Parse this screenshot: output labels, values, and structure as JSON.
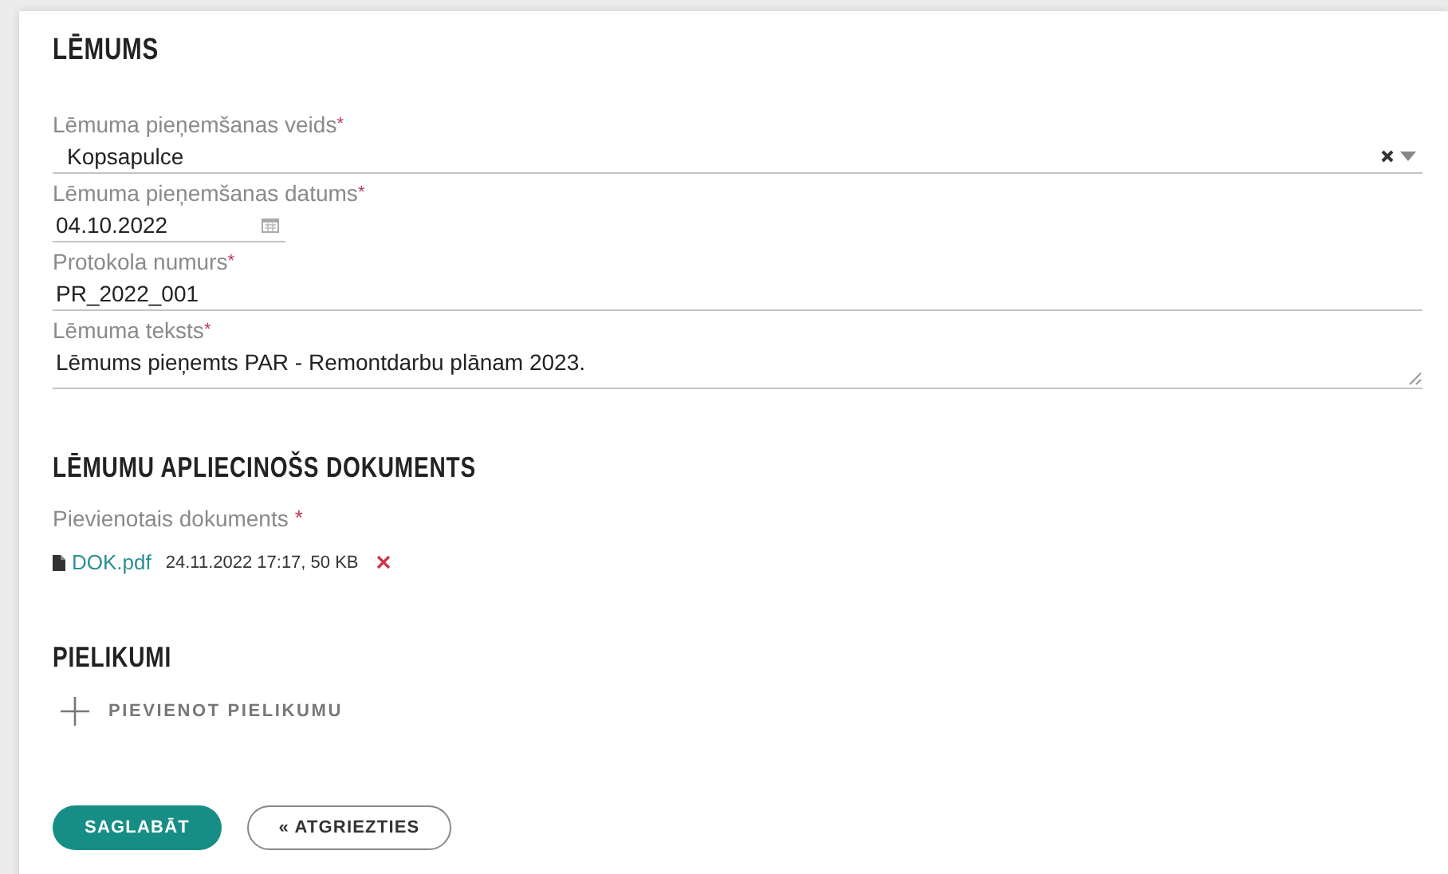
{
  "title": "LĒMUMS",
  "fields": [
    {
      "kind": "select",
      "label": "Lēmuma pieņemšanas veids",
      "required_mark": "*",
      "value": "Kopsapulce"
    },
    {
      "kind": "date",
      "label": "Lēmuma pieņemšanas datums",
      "required_mark": "*",
      "value": "04.10.2022"
    },
    {
      "kind": "text",
      "label": "Protokola numurs",
      "required_mark": "*",
      "value": "PR_2022_001"
    },
    {
      "kind": "textarea",
      "label": "Lēmuma teksts",
      "required_mark": "*",
      "value": "Lēmums pieņemts PAR - Remontdarbu plānam 2023."
    }
  ],
  "document_section": {
    "title": "LĒMUMU APLIECINOŠS DOKUMENTS",
    "label": "Pievienotais dokuments",
    "required_mark": "*",
    "file": {
      "name": "DOK.pdf",
      "meta": "24.11.2022 17:17, 50 KB"
    }
  },
  "attachments_section": {
    "title": "PIELIKUMI",
    "add_label": "PIEVIENOT PIELIKUMU"
  },
  "buttons": [
    {
      "kind": "primary",
      "label": "SAGLABĀT"
    },
    {
      "kind": "secondary",
      "label": "« ATGRIEZTIES"
    }
  ]
}
